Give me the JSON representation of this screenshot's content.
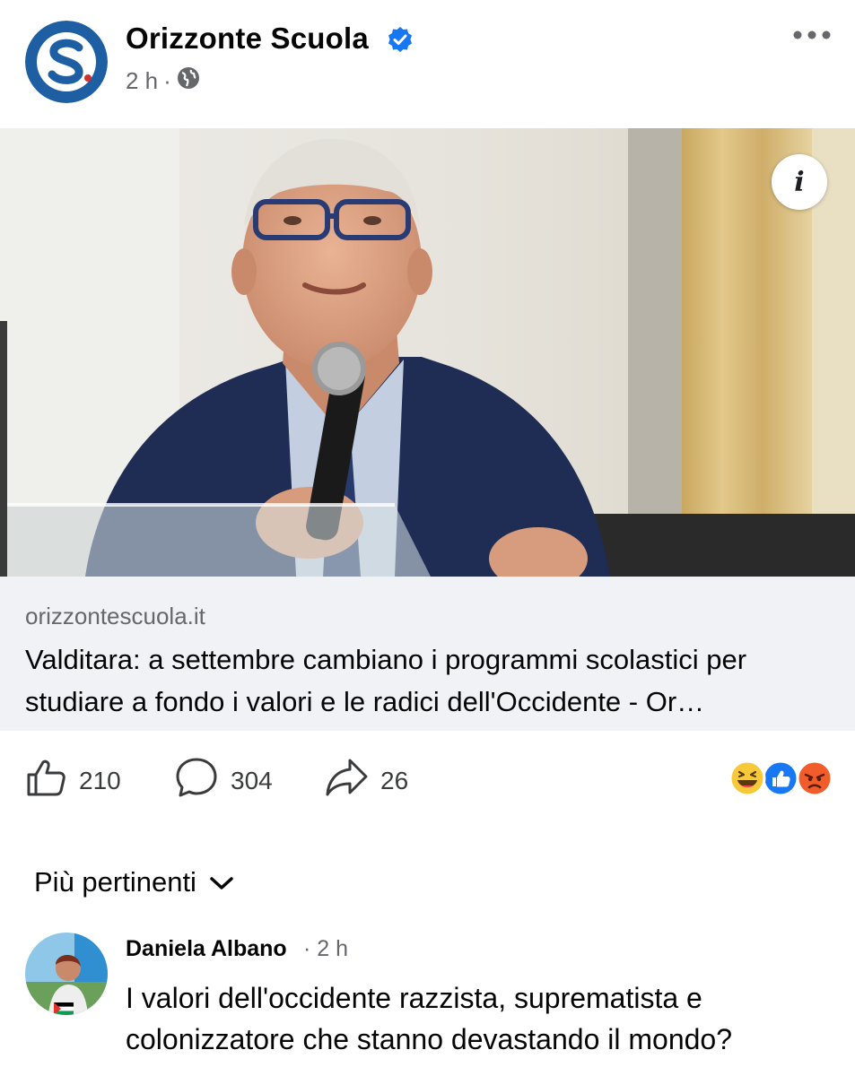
{
  "post": {
    "page_name": "Orizzonte Scuola",
    "time": "2 h",
    "separator": "·",
    "audience_icon": "globe-icon",
    "verified_icon": "verified-badge-icon",
    "more_icon": "more-options-icon"
  },
  "link_preview": {
    "domain": "orizzontescuola.it",
    "title": "Valditara: a settembre cambiano i programmi scolastici per studiare a fondo i valori e le radici dell'Occidente - Or…",
    "info_icon": "info-icon"
  },
  "actions": {
    "likes": "210",
    "comments": "304",
    "shares": "26",
    "reaction_icons": [
      "haha-icon",
      "like-icon",
      "angry-icon"
    ]
  },
  "comments": {
    "sort_label": "Più pertinenti",
    "items": [
      {
        "author": "Daniela Albano",
        "time": "· 2 h",
        "text": "I valori dell'occidente razzista, suprematista e colonizzatore che stanno devastando il mondo?"
      }
    ]
  },
  "colors": {
    "verified_blue": "#1877f2",
    "logo_blue": "#1e5fa3",
    "link_box_bg": "#f0f2f5",
    "secondary_text": "#65676b"
  }
}
